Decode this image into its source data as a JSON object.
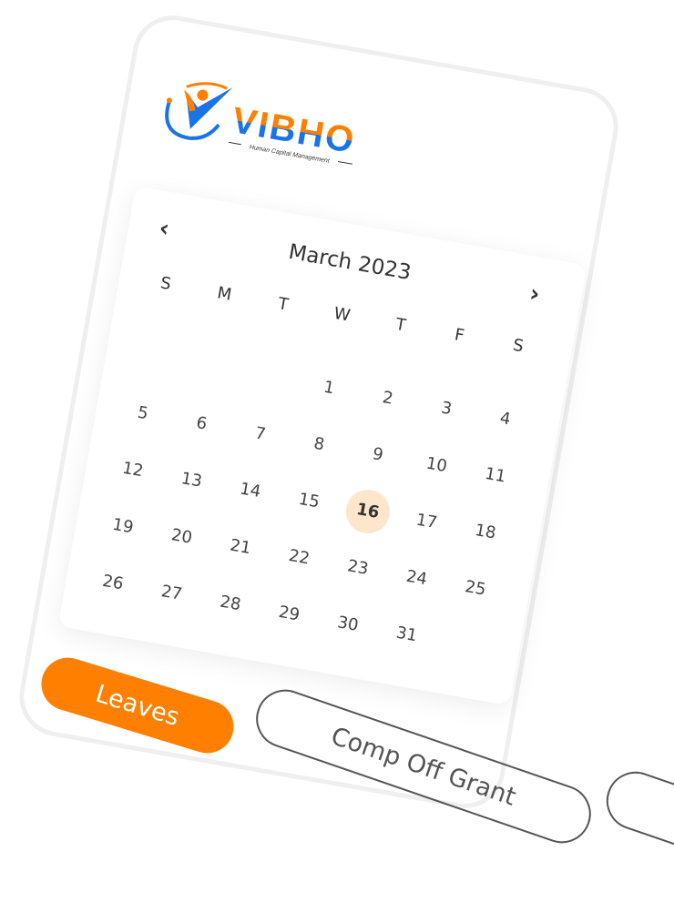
{
  "brand": {
    "name": "VIBHO",
    "tagline": "Human Capital Management",
    "orange": "#ff7f00",
    "blue": "#1a73e8"
  },
  "calendar": {
    "month_label": "March 2023",
    "prev_icon": "chevron-left-icon",
    "next_icon": "chevron-right-icon",
    "weekdays": [
      "S",
      "M",
      "T",
      "W",
      "T",
      "F",
      "S"
    ],
    "first_weekday_index": 3,
    "days": [
      "1",
      "2",
      "3",
      "4",
      "5",
      "6",
      "7",
      "8",
      "9",
      "10",
      "11",
      "12",
      "13",
      "14",
      "15",
      "16",
      "17",
      "18",
      "19",
      "20",
      "21",
      "22",
      "23",
      "24",
      "25",
      "26",
      "27",
      "28",
      "29",
      "30",
      "31"
    ],
    "selected_day": "16",
    "selected_color": "#fde6cc"
  },
  "tabs": [
    {
      "label": "Leaves",
      "active": true
    },
    {
      "label": "Comp Off Grant",
      "active": false
    },
    {
      "label": "",
      "active": false
    }
  ]
}
